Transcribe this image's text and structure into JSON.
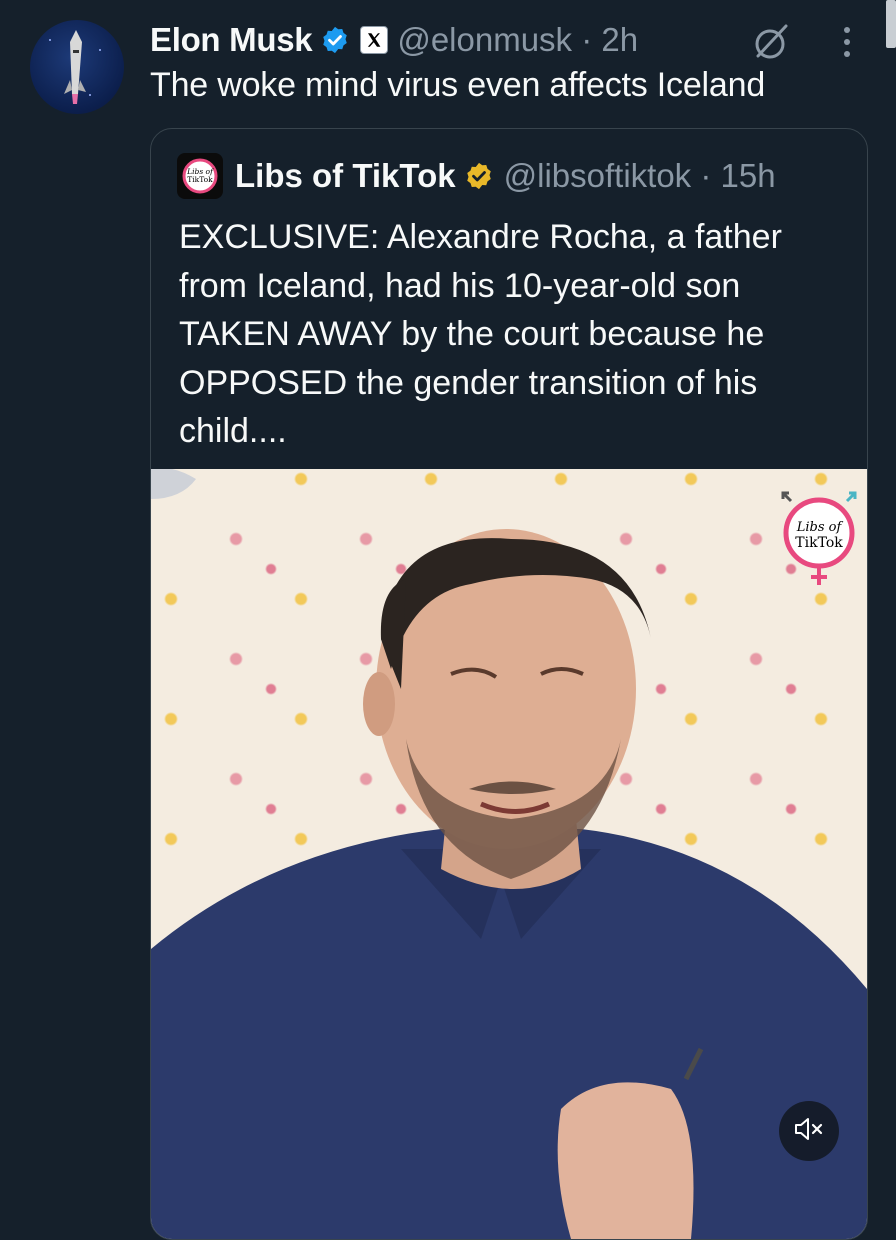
{
  "tweet": {
    "author": {
      "name": "Elon Musk",
      "handle_time": "@elonmusk · 2h",
      "verified_color": "#1d9bf0"
    },
    "text": "The woke mind virus even affects Iceland",
    "icons": [
      "grok-icon",
      "more-icon"
    ]
  },
  "quoted_tweet": {
    "author": {
      "name": "Libs of TikTok",
      "handle_time": "@libsoftiktok · 15h",
      "avatar_text": [
        "Libs of",
        "TikTok"
      ],
      "verified_color": "#e8b829"
    },
    "text": "EXCLUSIVE: Alexandre Rocha, a father\nfrom Iceland, had his 10-year-old son\nTAKEN AWAY by the court because he\nOPPOSED the gender transition of his\nchild....",
    "media": {
      "type": "video",
      "watermark_text": [
        "Libs of",
        "TikTok"
      ],
      "muted": true
    }
  },
  "colors": {
    "background": "#15202b",
    "text": "#f7f9f9",
    "secondary": "#8b98a5",
    "border": "#38444d"
  }
}
